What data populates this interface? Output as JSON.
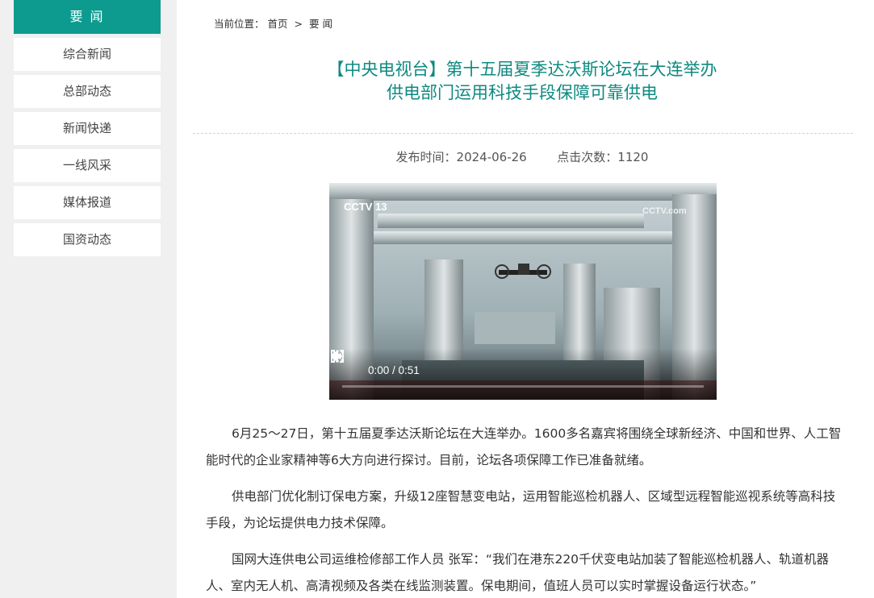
{
  "sidebar": {
    "header": "要 闻",
    "items": [
      {
        "label": "综合新闻"
      },
      {
        "label": "总部动态"
      },
      {
        "label": "新闻快递"
      },
      {
        "label": "一线风采"
      },
      {
        "label": "媒体报道"
      },
      {
        "label": "国资动态"
      }
    ]
  },
  "breadcrumb": {
    "prefix": "当前位置：",
    "home": "首页",
    "separator": ">",
    "current": "要 闻"
  },
  "article": {
    "title_line1": "【中央电视台】第十五届夏季达沃斯论坛在大连举办",
    "title_line2": "供电部门运用科技手段保障可靠供电",
    "publish_label": "发布时间：",
    "publish_date": "2024-06-26",
    "views_label": "点击次数：",
    "views": "1120",
    "paragraphs": [
      "6月25～27日，第十五届夏季达沃斯论坛在大连举办。1600多名嘉宾将围绕全球新经济、中国和世界、人工智能时代的企业家精神等6大方向进行探讨。目前，论坛各项保障工作已准备就绪。",
      "供电部门优化制订保电方案，升级12座智慧变电站，运用智能巡检机器人、区域型远程智能巡视系统等高科技手段，为论坛提供电力技术保障。",
      "国网大连供电公司运维检修部工作人员 张军：“我们在港东220千伏变电站加装了智能巡检机器人、轨道机器人、室内无人机、高清视频及各类在线监测装置。保电期间，值班人员可以实时掌握设备运行状态。”"
    ]
  },
  "video": {
    "time_display": "0:00 / 0:51",
    "progress": 0,
    "watermark_left": "CCTV 13",
    "watermark_right": "CCTV.com"
  },
  "colors": {
    "accent": "#0e9b8f",
    "title": "#0e8a80"
  }
}
